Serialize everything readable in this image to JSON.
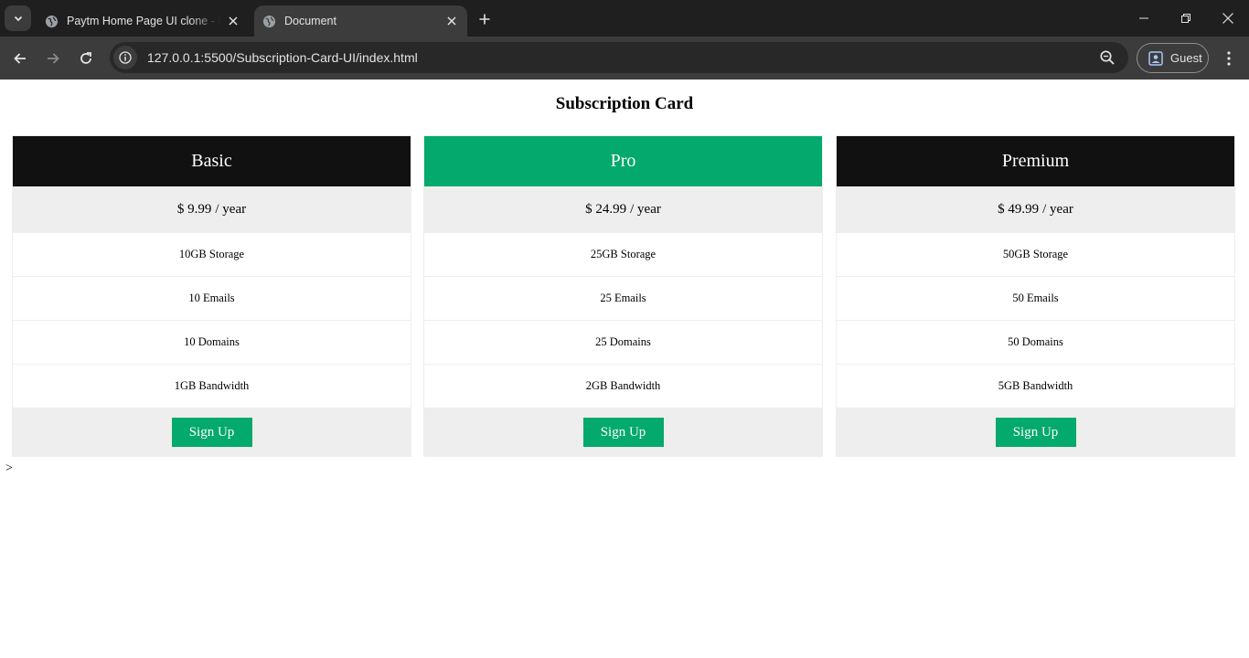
{
  "browser": {
    "tabs": [
      {
        "title": "Paytm Home Page UI clone - by",
        "active": false
      },
      {
        "title": "Document",
        "active": true
      }
    ],
    "url_host": "127.0.0.1",
    "url_rest": ":5500/Subscription-Card-UI/index.html",
    "profile_label": "Guest",
    "icons": {
      "tab_search": "chevron-down-icon",
      "favicon": "globe-icon",
      "tab_close": "close-icon",
      "new_tab": "plus-icon",
      "back": "arrow-left-icon",
      "forward": "arrow-right-icon",
      "reload": "reload-icon",
      "site_info": "info-icon",
      "zoom": "zoom-icon",
      "profile": "person-icon",
      "menu": "kebab-menu-icon"
    }
  },
  "page": {
    "title": "Subscription Card",
    "stray_text": ">",
    "colors": {
      "accent": "#04a96d",
      "dark_header": "#111111",
      "row_bg": "#eeeeee"
    },
    "cards": [
      {
        "name": "Basic",
        "price": "$ 9.99",
        "period": "/ year",
        "features": [
          "10GB Storage",
          "10 Emails",
          "10 Domains",
          "1GB Bandwidth"
        ],
        "button": "Sign Up"
      },
      {
        "name": "Pro",
        "price": "$ 24.99",
        "period": "/ year",
        "features": [
          "25GB Storage",
          "25 Emails",
          "25 Domains",
          "2GB Bandwidth"
        ],
        "button": "Sign Up"
      },
      {
        "name": "Premium",
        "price": "$ 49.99",
        "period": "/ year",
        "features": [
          "50GB Storage",
          "50 Emails",
          "50 Domains",
          "5GB Bandwidth"
        ],
        "button": "Sign Up"
      }
    ]
  }
}
